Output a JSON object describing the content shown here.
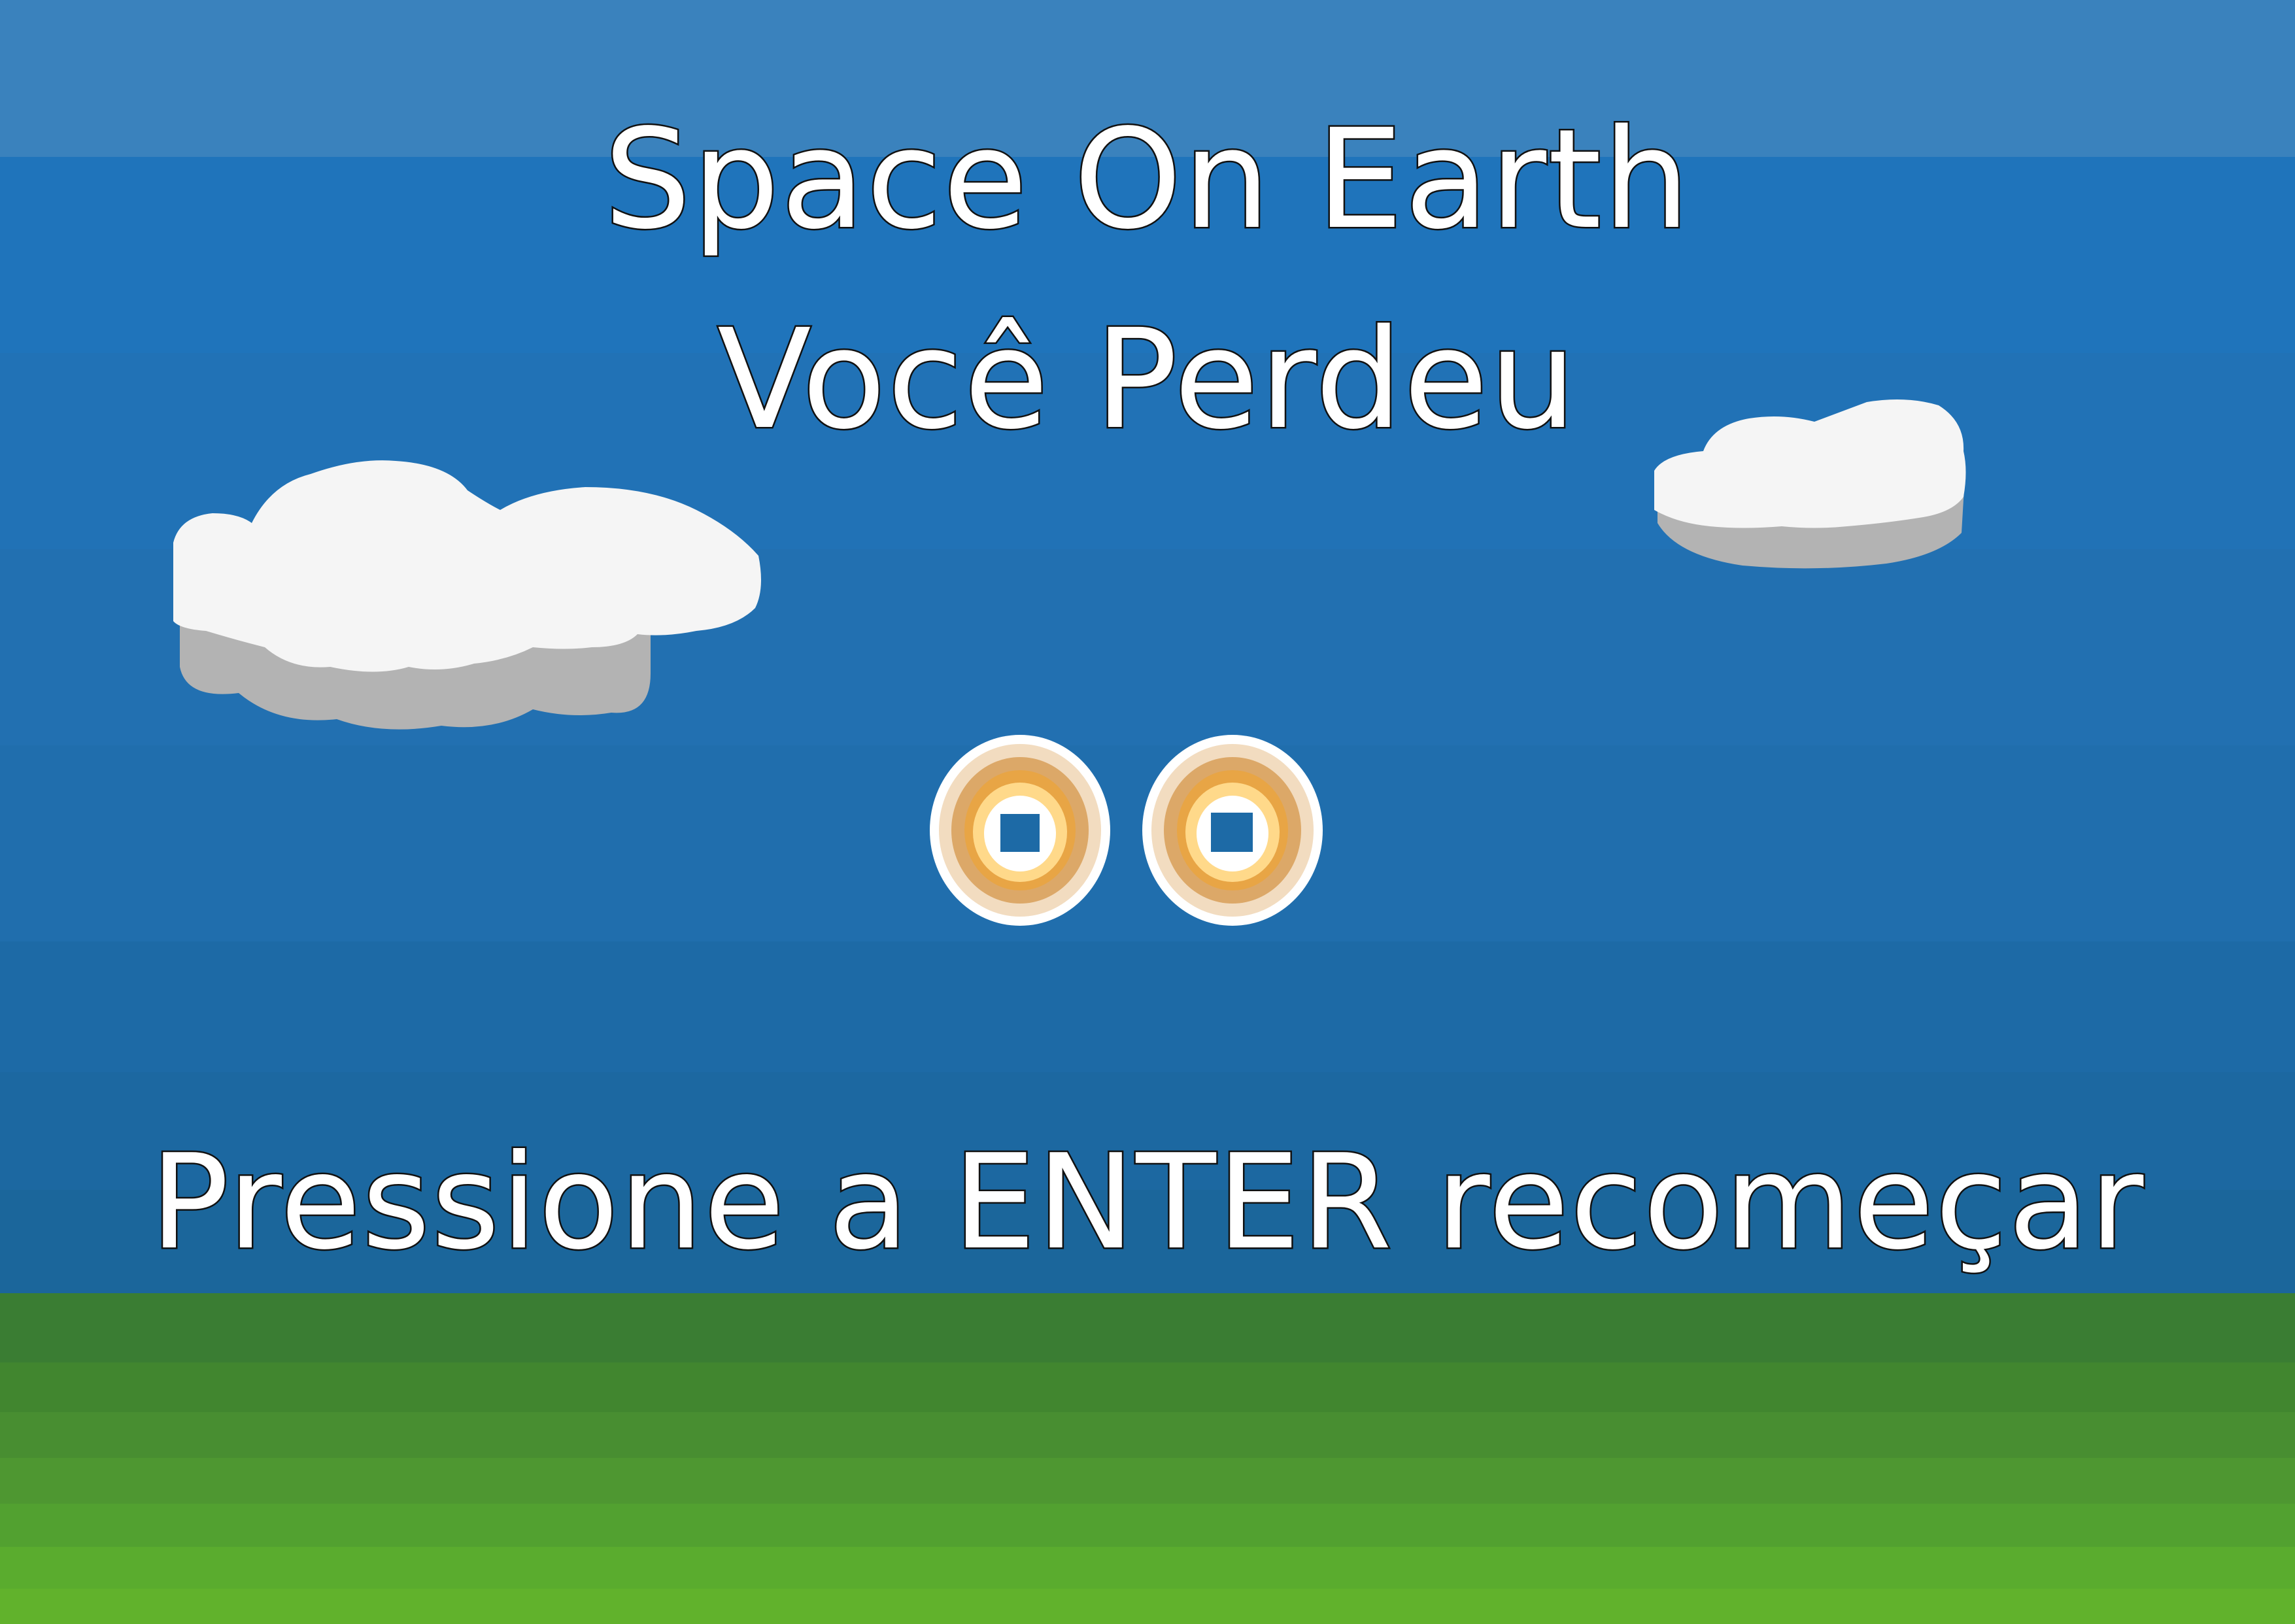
{
  "game": {
    "title": "Space On Earth",
    "status": "Você Perdeu",
    "restart_prompt": "Pressione a ENTER recomeçar"
  },
  "colors": {
    "sky_bands": [
      "#3a82bd",
      "#1f74bb",
      "#2172b6",
      "#2270b1",
      "#206ead",
      "#1d6aa6",
      "#1c68a1",
      "#1b669b"
    ],
    "grass_bands": [
      "#3a7d33",
      "#41862f",
      "#488e31",
      "#4e9731",
      "#52a130",
      "#5aac2e",
      "#61b22c"
    ],
    "cloud_white": "#f5f5f5",
    "cloud_shadow": "#b3b3b3",
    "text_fill": "#ffffff",
    "text_outline": "#111111",
    "coin_gold": "#e8a545"
  },
  "sprites": {
    "clouds": [
      "cloud-large",
      "cloud-small"
    ],
    "coins": [
      "ring-coin",
      "ring-coin"
    ]
  }
}
